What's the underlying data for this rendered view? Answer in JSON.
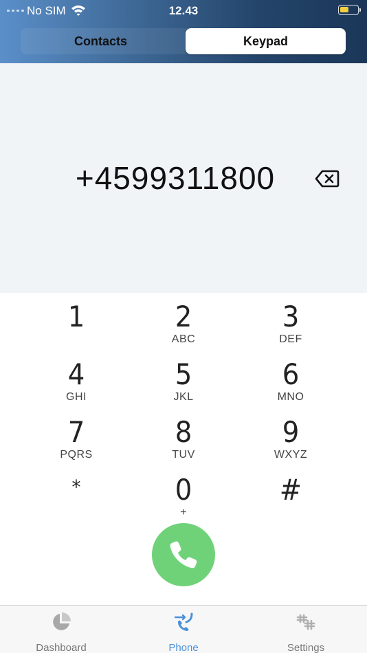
{
  "status_bar": {
    "carrier": "No SIM",
    "time": "12.43",
    "battery_color": "#f4d03f"
  },
  "segment": {
    "contacts_label": "Contacts",
    "keypad_label": "Keypad",
    "selected": "Keypad"
  },
  "dial": {
    "number": "+4599311800"
  },
  "keys": [
    {
      "digit": "1",
      "letters": ""
    },
    {
      "digit": "2",
      "letters": "ABC"
    },
    {
      "digit": "3",
      "letters": "DEF"
    },
    {
      "digit": "4",
      "letters": "GHI"
    },
    {
      "digit": "5",
      "letters": "JKL"
    },
    {
      "digit": "6",
      "letters": "MNO"
    },
    {
      "digit": "7",
      "letters": "PQRS"
    },
    {
      "digit": "8",
      "letters": "TUV"
    },
    {
      "digit": "9",
      "letters": "WXYZ"
    },
    {
      "digit": "*",
      "letters": ""
    },
    {
      "digit": "0",
      "letters": "+"
    },
    {
      "digit": "#",
      "letters": ""
    }
  ],
  "call_button": {
    "icon": "phone-icon",
    "color": "#6fd278"
  },
  "tabs": [
    {
      "label": "Dashboard",
      "icon": "pie-chart-icon"
    },
    {
      "label": "Phone",
      "icon": "phone-transfer-icon",
      "active": true
    },
    {
      "label": "Settings",
      "icon": "settings-hash-icon"
    }
  ],
  "colors": {
    "accent": "#4a90d9",
    "header_start": "#5b8fc9",
    "header_end": "#1b3658"
  }
}
